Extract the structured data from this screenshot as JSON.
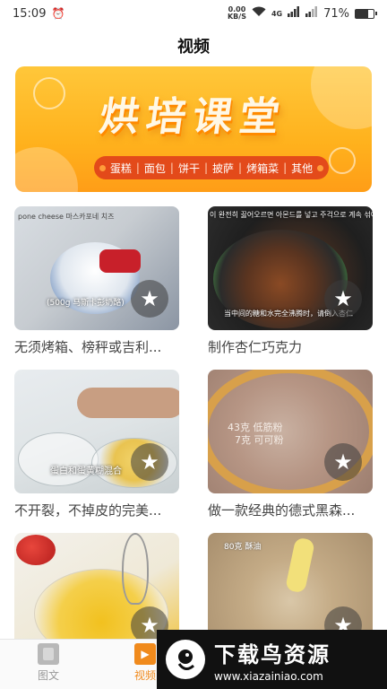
{
  "status": {
    "time": "15:09",
    "net_speed_value": "0.00",
    "net_speed_unit": "KB/S",
    "signal_label": "4G",
    "battery": "71%",
    "battery_level": 0.71
  },
  "header": {
    "title": "视频"
  },
  "banner": {
    "title": "烘培课堂",
    "categories": [
      "蛋糕",
      "面包",
      "饼干",
      "披萨",
      "烤箱菜",
      "其他"
    ]
  },
  "videos": [
    {
      "title": "无须烤箱、榜秤或吉利...",
      "overlay_top": "pone cheese  마스카포네 치즈",
      "overlay_bottom": "(500g 马斯卡彭奶酪)"
    },
    {
      "title": "制作杏仁巧克力",
      "overlay_top": "이 완전히 끓어오르면 아몬드를 넣고 주걱으로 계속 섞어 주세",
      "overlay_bottom": "当中间的糖和水完全沸腾时，请倒入杏仁"
    },
    {
      "title": "不开裂，不掉皮的完美...",
      "overlay_bottom": "蛋白和蛋黄糊混合"
    },
    {
      "title": "做一款经典的德式黑森...",
      "overlay_top": "43克 低筋粉",
      "overlay_bottom": "7克 可可粉"
    },
    {
      "title": "",
      "overlay_top": ""
    },
    {
      "title": "",
      "overlay_top": "80克 酥油"
    }
  ],
  "tabbar": {
    "tabs": [
      {
        "label": "图文",
        "icon": "document-icon"
      },
      {
        "label": "视频",
        "icon": "video-icon"
      }
    ],
    "active_color": "#f08a1c"
  },
  "watermark": {
    "title": "下载鸟资源",
    "url": "www.xiazainiao.com"
  },
  "icons": {
    "favorite": "star-icon",
    "alarm": "alarm-icon",
    "wifi": "wifi-icon"
  }
}
